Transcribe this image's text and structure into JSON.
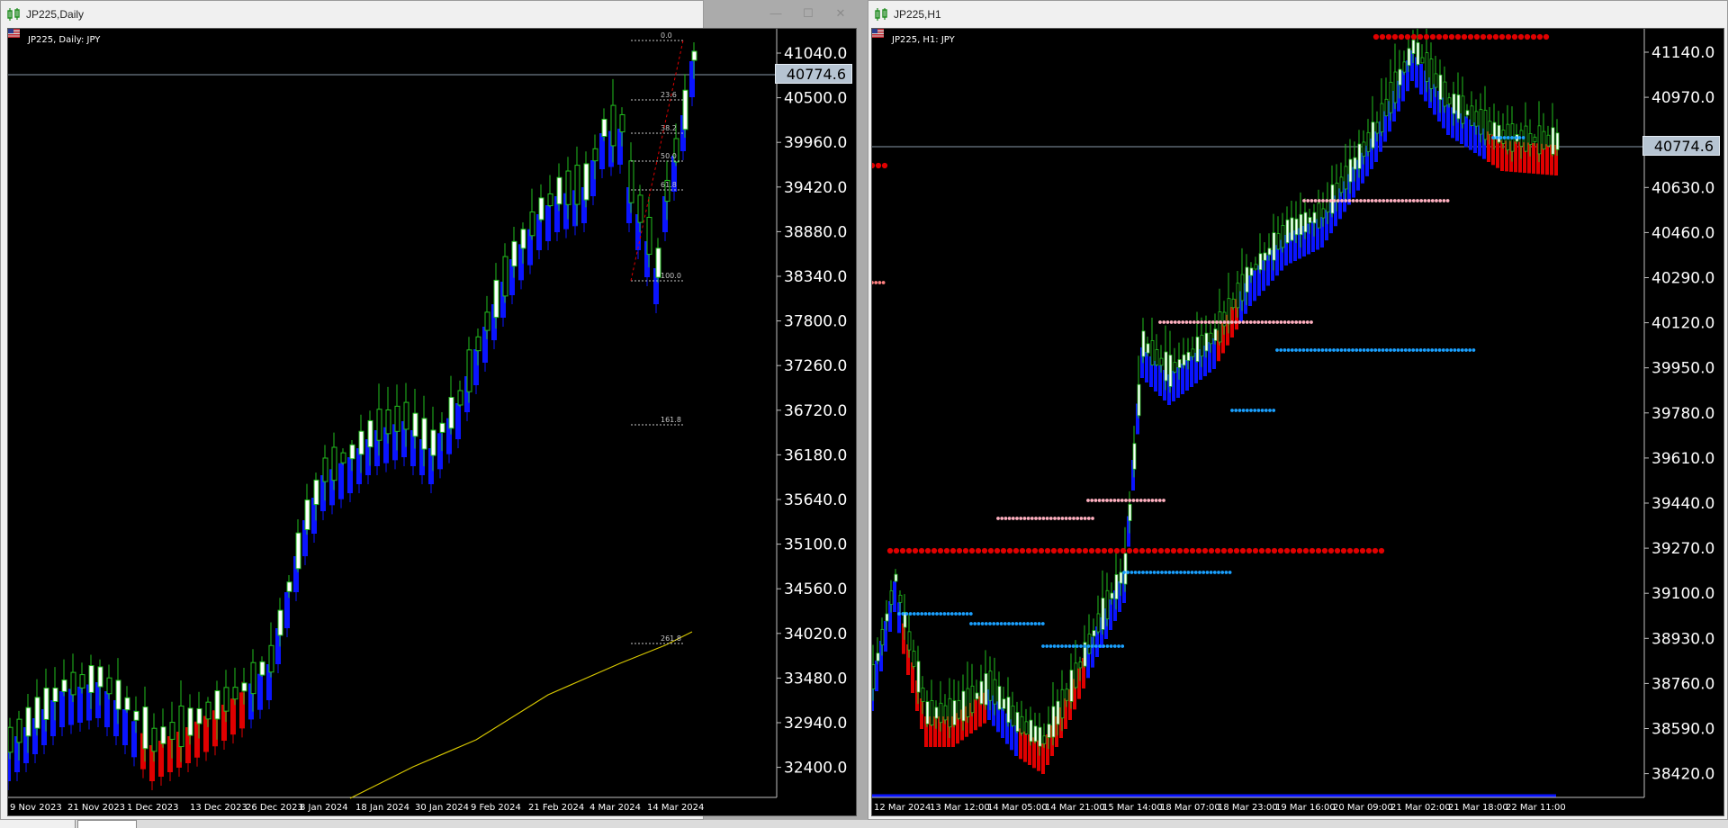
{
  "left_window": {
    "title": "JP225,Daily",
    "chart_label": "JP225, Daily: JPY",
    "current_price": "40774.6",
    "price_labels": [
      "41040.0",
      "40500.0",
      "39960.0",
      "39420.0",
      "38880.0",
      "38340.0",
      "37800.0",
      "37260.0",
      "36720.0",
      "36180.0",
      "35640.0",
      "35100.0",
      "34560.0",
      "34020.0",
      "33480.0",
      "32940.0",
      "32400.0"
    ],
    "date_labels": [
      "9 Nov 2023",
      "21 Nov 2023",
      "1 Dec 2023",
      "13 Dec 2023",
      "26 Dec 2023",
      "8 Jan 2024",
      "18 Jan 2024",
      "30 Jan 2024",
      "9 Feb 2024",
      "21 Feb 2024",
      "4 Mar 2024",
      "14 Mar 2024"
    ],
    "fib_levels": [
      "0.0",
      "23.6",
      "38.2",
      "50.0",
      "61.8",
      "100.0",
      "161.8",
      "261.8"
    ]
  },
  "right_window": {
    "title": "JP225,H1",
    "chart_label": "JP225, H1: JPY",
    "current_price": "40774.6",
    "price_labels": [
      "41140.0",
      "40970.0",
      "40800.0",
      "40630.0",
      "40460.0",
      "40290.0",
      "40120.0",
      "39950.0",
      "39780.0",
      "39610.0",
      "39440.0",
      "39270.0",
      "39100.0",
      "38930.0",
      "38760.0",
      "38590.0",
      "38420.0"
    ],
    "date_labels": [
      "12 Mar 2024",
      "13 Mar 12:00",
      "14 Mar 05:00",
      "14 Mar 21:00",
      "15 Mar 14:00",
      "18 Mar 07:00",
      "18 Mar 23:00",
      "19 Mar 16:00",
      "20 Mar 09:00",
      "21 Mar 02:00",
      "21 Mar 18:00",
      "22 Mar 11:00"
    ]
  },
  "window_controls": {
    "minimize": "—",
    "maximize": "☐",
    "close": "✕"
  },
  "colors": {
    "bull": "#22c01e",
    "bear_body": "#ffffff",
    "blue_band": "#0a14ff",
    "red_band": "#e00000",
    "yellow_ma": "#d8c800",
    "pink_dots": "#ffb0c0",
    "cyan_dots": "#1aa0ff",
    "axis_text": "#ffffff"
  },
  "icons": {
    "app": "mt-chart-icon",
    "flag": "us-flag-icon"
  }
}
